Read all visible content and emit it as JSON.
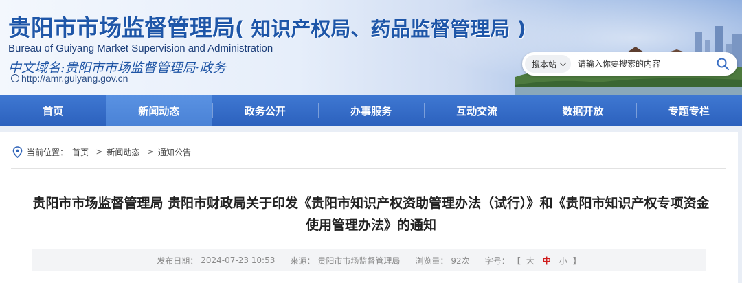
{
  "header": {
    "title_main": "贵阳市市场监督管理局",
    "title_sub": "( 知识产权局、药品监督管理局 )",
    "title_en": "Bureau of Guiyang Market Supervision and Administration",
    "domain_cn": "中文域名:贵阳市市场监督管理局·政务",
    "domain_url": "http://amr.guiyang.gov.cn"
  },
  "search": {
    "scope": "搜本站",
    "placeholder": "请输入你要搜索的内容"
  },
  "nav": {
    "items": [
      {
        "label": "首页"
      },
      {
        "label": "新闻动态"
      },
      {
        "label": "政务公开"
      },
      {
        "label": "办事服务"
      },
      {
        "label": "互动交流"
      },
      {
        "label": "数据开放"
      },
      {
        "label": "专题专栏"
      }
    ],
    "active_index": 1
  },
  "breadcrumb": {
    "prefix": "当前位置：",
    "sep": "->",
    "items": [
      "首页",
      "新闻动态",
      "通知公告"
    ]
  },
  "article": {
    "title": "贵阳市市场监督管理局 贵阳市财政局关于印发《贵阳市知识产权资助管理办法（试行）》和《贵阳市知识产权专项资金使用管理办法》的通知",
    "meta": {
      "date_label": "发布日期：",
      "date": "2024-07-23 10:53",
      "source_label": "来源：",
      "source": "贵阳市市场监督管理局",
      "views_label": "浏览量：",
      "views": "92次",
      "font_label": "字号：",
      "font_open": "【",
      "font_large": "大",
      "font_medium": "中",
      "font_small": "小",
      "font_close": "】"
    }
  },
  "colors": {
    "brand_blue": "#1e56a8",
    "nav_blue": "#2c61bd",
    "nav_active": "#4a82d6",
    "font_active": "#d01c1c"
  }
}
